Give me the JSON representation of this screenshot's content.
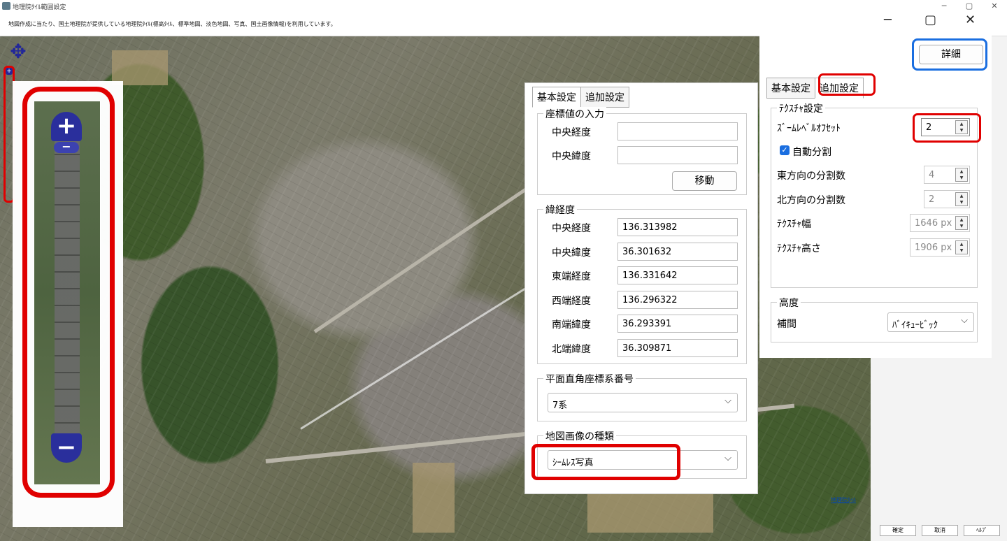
{
  "window": {
    "title": "地理院ﾀｲﾙ範囲設定",
    "minimize": "─",
    "maximize": "▢",
    "close": "✕"
  },
  "info": {
    "text": "地図作成に当たり、国土地理院が提供している地理院ﾀｲﾙ(標高ﾀｲﾙ、標準地図、淡色地図、写真、国土画像情報)を利用しています。"
  },
  "map": {
    "link": "地理院ﾀｲﾙ",
    "nav_icon": "pan-cross-icon",
    "zoom_plus": "+",
    "zoom_minus": "−"
  },
  "panelA": {
    "tabs": [
      "基本設定",
      "追加設定"
    ],
    "coord_group": "座標値の入力",
    "center_lon_label": "中央経度",
    "center_lat_label": "中央緯度",
    "center_lon_value": "",
    "center_lat_value": "",
    "move_button": "移動",
    "latlon_group": "緯経度",
    "rows": [
      {
        "label": "中央経度",
        "value": "136.313982"
      },
      {
        "label": "中央緯度",
        "value": "36.301632"
      },
      {
        "label": "東端経度",
        "value": "136.331642"
      },
      {
        "label": "西端経度",
        "value": "136.296322"
      },
      {
        "label": "南端緯度",
        "value": "36.293391"
      },
      {
        "label": "北端緯度",
        "value": "36.309871"
      }
    ],
    "plane_group": "平面直角座標系番号",
    "plane_value": "7系",
    "imgtype_group": "地図画像の種類",
    "imgtype_value": "ｼｰﾑﾚｽ写真"
  },
  "panelB": {
    "detail_button": "詳細",
    "tabs": [
      "基本設定",
      "追加設定"
    ],
    "texture_group": "ﾃｸｽﾁｬ設定",
    "zoom_offset_label": "ｽﾞｰﾑﾚﾍﾞﾙｵﾌｾｯﾄ",
    "zoom_offset_value": "2",
    "auto_split_label": "自動分割",
    "east_split_label": "東方向の分割数",
    "east_split_value": "4",
    "north_split_label": "北方向の分割数",
    "north_split_value": "2",
    "tex_width_label": "ﾃｸｽﾁｬ幅",
    "tex_width_value": "1646 px",
    "tex_height_label": "ﾃｸｽﾁｬ高さ",
    "tex_height_value": "1906 px",
    "height_group": "高度",
    "interp_label": "補間",
    "interp_value": "ﾊﾞｲｷｭｰﾋﾞｯｸ"
  },
  "footer": {
    "ok": "確定",
    "cancel": "取消",
    "help": "ﾍﾙﾌﾟ"
  }
}
